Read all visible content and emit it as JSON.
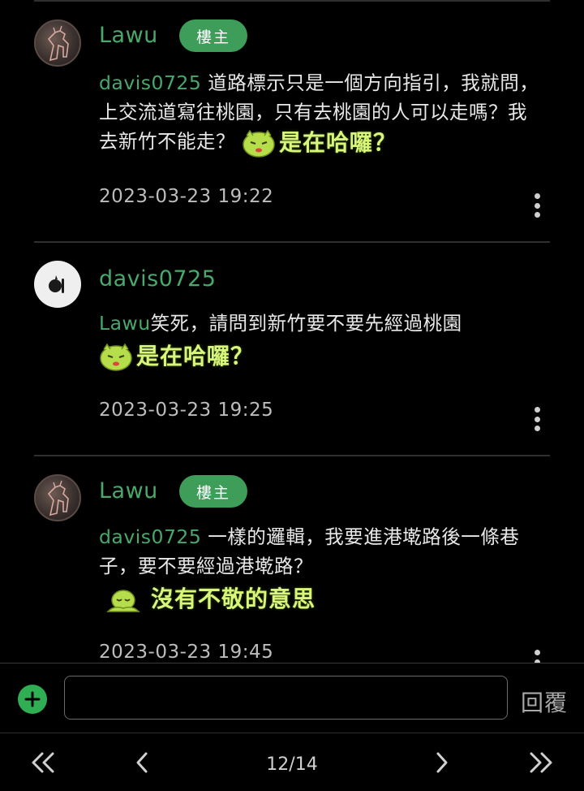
{
  "comments": [
    {
      "username": "Lawu",
      "badge": "樓主",
      "mention": "davis0725",
      "text": " 道路標示只是一個方向指引，我就問，上交流道寫往桃園，只有去桃園的人可以走嗎？我去新竹不能走？",
      "sticker": "是在哈囉？",
      "timestamp": "2023-03-23 19:22"
    },
    {
      "username": "davis0725",
      "mention": "Lawu",
      "text": "笑死，請問到新竹要不要先經過桃園",
      "sticker": "是在哈囉？",
      "timestamp": "2023-03-23 19:25"
    },
    {
      "username": "Lawu",
      "badge": "樓主",
      "mention": "davis0725",
      "text": " 一樣的邏輯，我要進港墘路後一條巷子，要不要經過港墘路？",
      "sticker": "沒有不敬的意思",
      "timestamp": "2023-03-23 19:45"
    }
  ],
  "reply": {
    "input_value": "",
    "button_label": "回覆"
  },
  "pagination": {
    "page_label": "12/14"
  },
  "colors": {
    "accent": "#49a86b",
    "badge": "#3f9d5a",
    "sticker_text": "#d8f77a"
  }
}
